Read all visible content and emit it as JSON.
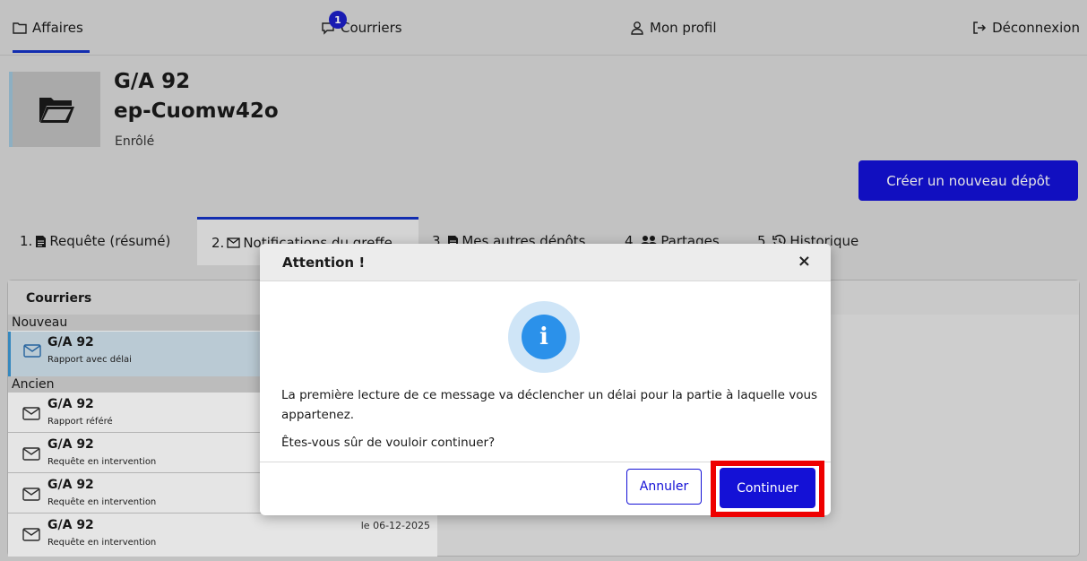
{
  "nav": {
    "affaires": "Affaires",
    "courriers": "Courriers",
    "courriers_badge": "1",
    "profil": "Mon profil",
    "deconnexion": "Déconnexion"
  },
  "case": {
    "title": "G/A 92",
    "subtitle": "ep-Cuomw42o",
    "status": "Enrôlé",
    "new_depot_label": "Créer un nouveau dépôt"
  },
  "tabs": [
    {
      "num": "1.",
      "label": "Requête (résumé)"
    },
    {
      "num": "2.",
      "label": "Notifications du greffe"
    },
    {
      "num": "3.",
      "label": "Mes autres dépôts"
    },
    {
      "num": "4.",
      "label": "Partages"
    },
    {
      "num": "5.",
      "label": "Historique"
    }
  ],
  "mailbox": {
    "header": "Courriers",
    "section_new": "Nouveau",
    "section_old": "Ancien",
    "new_items": [
      {
        "title": "G/A 92",
        "subtitle": "Rapport avec délai",
        "date": ""
      }
    ],
    "old_items": [
      {
        "title": "G/A 92",
        "subtitle": "Rapport référé",
        "date": ""
      },
      {
        "title": "G/A 92",
        "subtitle": "Requête en intervention",
        "date": ""
      },
      {
        "title": "G/A 92",
        "subtitle": "Requête en intervention",
        "date": ""
      },
      {
        "title": "G/A 92",
        "subtitle": "Requête en intervention",
        "date": "le 06-12-2025"
      }
    ]
  },
  "modal": {
    "title": "Attention !",
    "close": "×",
    "message": "La première lecture de ce message va déclencher un délai pour la partie à laquelle vous appartenez.",
    "question": "Êtes-vous sûr de vouloir continuer?",
    "cancel_label": "Annuler",
    "continue_label": "Continuer"
  },
  "colors": {
    "primary": "#1411d6",
    "accent_underline": "#1533c4",
    "highlight": "#ee0000",
    "info": "#2b91ea"
  }
}
